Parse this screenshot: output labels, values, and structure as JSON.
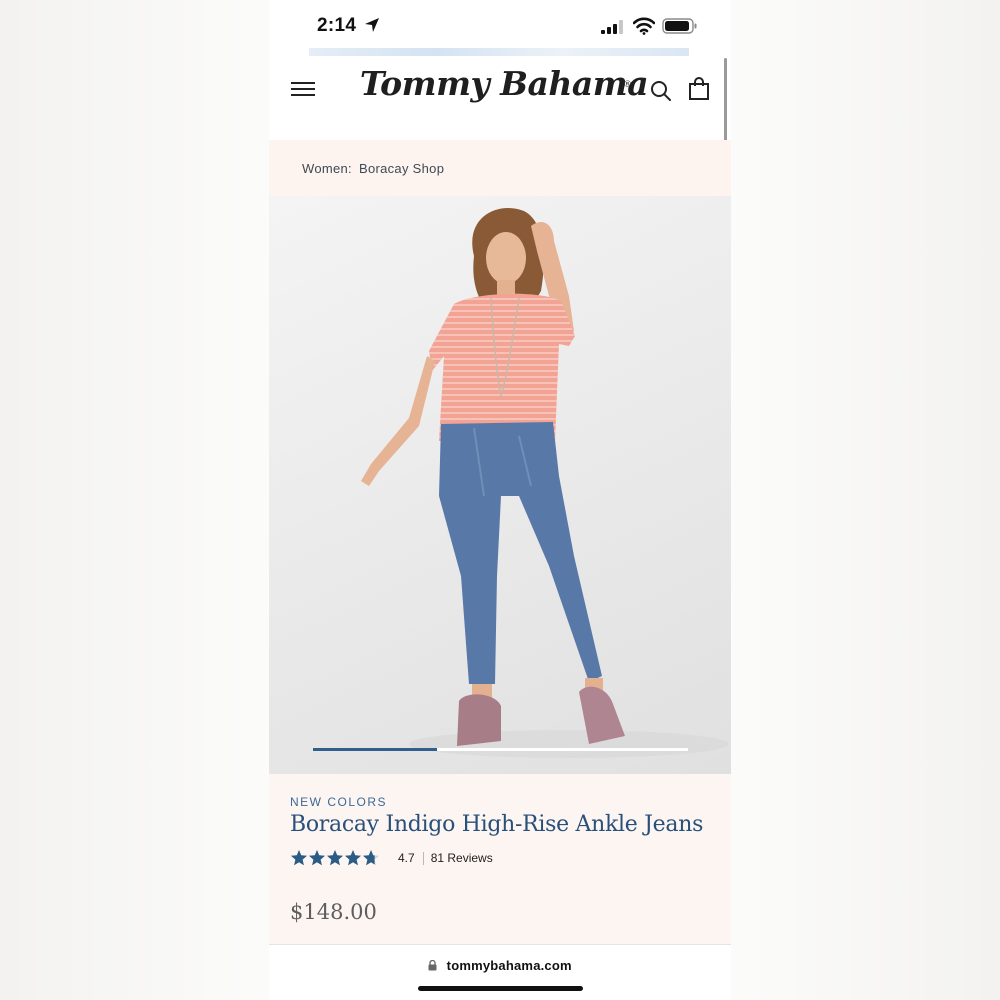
{
  "status_bar": {
    "time": "2:14",
    "icons": [
      "location-arrow-icon",
      "cellular-signal-icon",
      "wifi-icon",
      "battery-icon"
    ]
  },
  "header": {
    "logo_text": "Tommy Bahama",
    "logo_mark": "®",
    "icons": [
      "menu-icon",
      "search-icon",
      "shopping-bag-icon"
    ]
  },
  "breadcrumb": {
    "items": [
      "Women:",
      "Boracay Shop"
    ]
  },
  "hero": {
    "image_alt": "model wearing pink short-sleeve top and blue ankle jeans",
    "carousel_progress": 0.33
  },
  "product": {
    "badge": "NEW COLORS",
    "title": "Boracay Indigo High-Rise Ankle Jeans",
    "rating_value": "4.7",
    "rating_stars": 4.7,
    "reviews": "81 Reviews",
    "price": "$148.00"
  },
  "browser": {
    "url": "tommybahama.com"
  },
  "colors": {
    "accent_blue": "#28507a",
    "star_blue": "#2a5c86",
    "breadcrumb_bg": "#fdf3ef",
    "panel_bg": "#fdf5f1",
    "carousel_fill": "#2f5f8a"
  }
}
